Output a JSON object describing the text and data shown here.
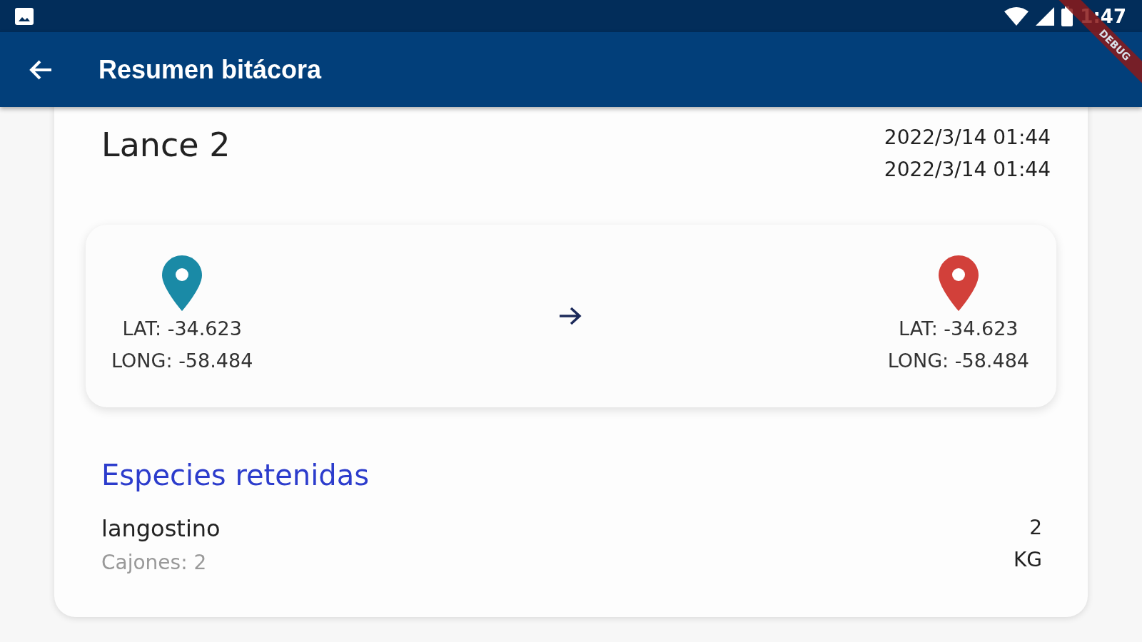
{
  "status_bar": {
    "time": "1:47"
  },
  "debug_banner": {
    "label": "DEBUG"
  },
  "app_bar": {
    "title": "Resumen bitácora"
  },
  "haul": {
    "title": "Lance 2",
    "start_time": "2022/3/14 01:44",
    "end_time": "2022/3/14 01:44"
  },
  "route": {
    "points": [
      {
        "color": "#1a8aa6",
        "lat": "LAT: -34.623",
        "long": "LONG: -58.484"
      },
      {
        "color": "#d2403a",
        "lat": "LAT: -34.623",
        "long": "LONG: -58.484"
      }
    ]
  },
  "species_section": {
    "title": "Especies retenidas",
    "items": [
      {
        "name": "langostino",
        "boxes": "Cajones: 2",
        "quantity": "2",
        "unit": "KG"
      }
    ]
  }
}
